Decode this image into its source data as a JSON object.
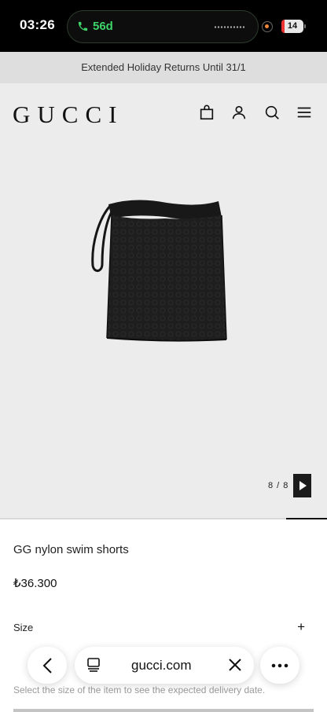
{
  "status_bar": {
    "time": "03:26",
    "call_duration": "56d",
    "battery": "14"
  },
  "promo_banner": "Extended Holiday Returns Until 31/1",
  "header": {
    "logo": "GUCCI",
    "icons": [
      "shopping-bag-icon",
      "account-icon",
      "search-icon",
      "menu-icon"
    ]
  },
  "gallery": {
    "counter": "8 / 8",
    "current": 8,
    "total": 8
  },
  "product": {
    "name": "GG nylon swim shorts",
    "price": "₺36.300",
    "size_label": "Size",
    "size_toggle": "+",
    "delivery_note": "Select the size of the item to see the expected delivery date."
  },
  "browser": {
    "url": "gucci.com"
  },
  "colors": {
    "background": "#ececec",
    "dark": "#1b1b1b",
    "call_green": "#3fd36a"
  }
}
